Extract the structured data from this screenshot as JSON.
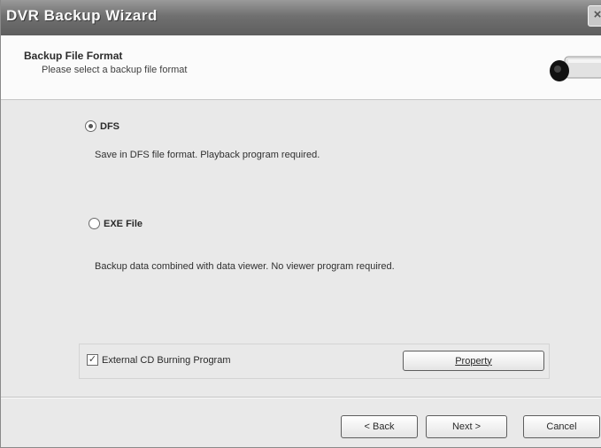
{
  "window": {
    "title": "DVR Backup Wizard",
    "close_glyph": "×"
  },
  "header": {
    "title": "Backup File Format",
    "subtitle": "Please select a backup file format",
    "icon": "camera-icon"
  },
  "formats": [
    {
      "label": "DFS",
      "description": "Save in DFS file format. Playback program required.",
      "selected": true
    },
    {
      "label": "EXE File",
      "description": "Backup data combined with data viewer. No viewer program required.",
      "selected": false
    }
  ],
  "options": {
    "external_cd_label": "External CD Burning Program",
    "external_cd_checked": true,
    "property_label": "Property"
  },
  "footer": {
    "back_label": "< Back",
    "next_label": "Next >",
    "cancel_label": "Cancel"
  }
}
